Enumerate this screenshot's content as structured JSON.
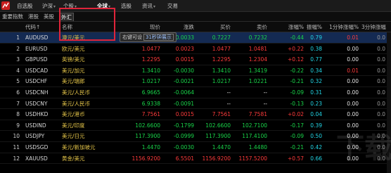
{
  "topbar": {
    "tabs": [
      {
        "label": "自选股",
        "active": false,
        "chevron": false
      },
      {
        "label": "沪深",
        "active": false,
        "chevron": true
      },
      {
        "label": "个股",
        "active": false,
        "chevron": true
      },
      {
        "label": "全球",
        "active": true,
        "chevron": true
      },
      {
        "label": "选股",
        "active": false,
        "chevron": false
      },
      {
        "label": "资讯",
        "active": false,
        "chevron": true
      },
      {
        "label": "交易",
        "active": false,
        "chevron": false
      }
    ]
  },
  "subbar": {
    "tabs": [
      {
        "label": "重要指数",
        "active": false
      },
      {
        "label": "港股",
        "active": false
      },
      {
        "label": "美股",
        "active": false
      },
      {
        "label": "外汇",
        "active": true
      }
    ]
  },
  "table": {
    "headers": {
      "code": "代码↑",
      "name": "名称",
      "price": "现价",
      "change": "涨跌",
      "buy": "买价",
      "sell": "卖价",
      "pct": "涨幅%",
      "amp": "振幅%",
      "m1": "1分钟涨幅%",
      "m3": "3分钟涨幅"
    },
    "rows": [
      {
        "num": "1",
        "code": "AUDUSD",
        "name": "澳元/美元",
        "price": "0.7227",
        "change": "-0.0033",
        "buy": "0.7227",
        "sell": "0.7232",
        "pct": "-0.44",
        "amp": "0.79",
        "m1": "0.01",
        "m3": "0.0",
        "dir": "dn"
      },
      {
        "num": "2",
        "code": "EURUSD",
        "name": "欧元/美元",
        "price": "1.0477",
        "change": "0.0023",
        "buy": "1.0477",
        "sell": "1.0481",
        "pct": "+0.22",
        "amp": "0.38",
        "m1": "0.00",
        "m3": "0.0",
        "dir": "up"
      },
      {
        "num": "3",
        "code": "GBPUSD",
        "name": "英镑/美元",
        "price": "1.2295",
        "change": "0.0015",
        "buy": "1.2295",
        "sell": "1.2304",
        "pct": "+0.12",
        "amp": "0.77",
        "m1": "0.00",
        "m3": "0.0",
        "dir": "up"
      },
      {
        "num": "4",
        "code": "USDCAD",
        "name": "美元/加元",
        "price": "1.3410",
        "change": "-0.0030",
        "buy": "1.3410",
        "sell": "1.3419",
        "pct": "-0.22",
        "amp": "0.34",
        "m1": "0.01",
        "m3": "0.0",
        "dir": "dn"
      },
      {
        "num": "5",
        "code": "USDCHF",
        "name": "美元/瑞郎",
        "price": "1.0217",
        "change": "-0.0021",
        "buy": "1.0217",
        "sell": "1.0221",
        "pct": "-0.21",
        "amp": "0.32",
        "m1": "0.00",
        "m3": "0.0",
        "dir": "dn"
      },
      {
        "num": "6",
        "code": "USDCNH",
        "name": "美元/人民币",
        "price": "6.9665",
        "change": "-0.0064",
        "buy": "--",
        "sell": "--",
        "pct": "-0.09",
        "amp": "0.31",
        "m1": "0.00",
        "m3": "0.0",
        "dir": "dn"
      },
      {
        "num": "7",
        "code": "USDCNY",
        "name": "美元/人民币",
        "price": "6.9338",
        "change": "-0.0091",
        "buy": "--",
        "sell": "--",
        "pct": "-0.13",
        "amp": "0.23",
        "m1": "0.00",
        "m3": "0.0",
        "dir": "dn"
      },
      {
        "num": "8",
        "code": "USDHKD",
        "name": "美元/港币",
        "price": "7.7561",
        "change": "0.0015",
        "buy": "7.7561",
        "sell": "7.7581",
        "pct": "+0.02",
        "amp": "0.04",
        "m1": "0.00",
        "m3": "0.0",
        "dir": "up"
      },
      {
        "num": "9",
        "code": "USDIND",
        "name": "美元/印度",
        "price": "102.6600",
        "change": "-0.1799",
        "buy": "102.6600",
        "sell": "102.7100",
        "pct": "-0.17",
        "amp": "0.39",
        "m1": "0.00",
        "m3": "0.0",
        "dir": "dn"
      },
      {
        "num": "10",
        "code": "USDJPY",
        "name": "美元/日元",
        "price": "117.3900",
        "change": "-0.0999",
        "buy": "117.3900",
        "sell": "117.4100",
        "pct": "-0.09",
        "amp": "0.50",
        "m1": "0.00",
        "m3": "0.0",
        "dir": "dn"
      },
      {
        "num": "11",
        "code": "USDSGD",
        "name": "美元/新加坡元",
        "price": "1.4470",
        "change": "-0.0030",
        "buy": "1.4470",
        "sell": "1.4480",
        "pct": "-0.21",
        "amp": "0.42",
        "m1": "0.00",
        "m3": "0.0",
        "dir": "dn"
      },
      {
        "num": "12",
        "code": "XAUUSD",
        "name": "黄金/美元",
        "price": "1156.9200",
        "change": "6.5501",
        "buy": "1156.9200",
        "sell": "1157.5200",
        "pct": "+0.57",
        "amp": "0.66",
        "m1": "0.00",
        "m3": "0.0",
        "dir": "up"
      }
    ]
  },
  "tooltip": {
    "hint": "右键可设",
    "highlight": "31秒钟展示"
  },
  "watermark": "下载吧",
  "colors": {
    "up": "#ff3b3b",
    "down": "#19d64a",
    "name": "#e8c84a",
    "amplitude": "#22d6e6",
    "selected_row": "#142a52",
    "highlight_frame": "#e0243a"
  }
}
